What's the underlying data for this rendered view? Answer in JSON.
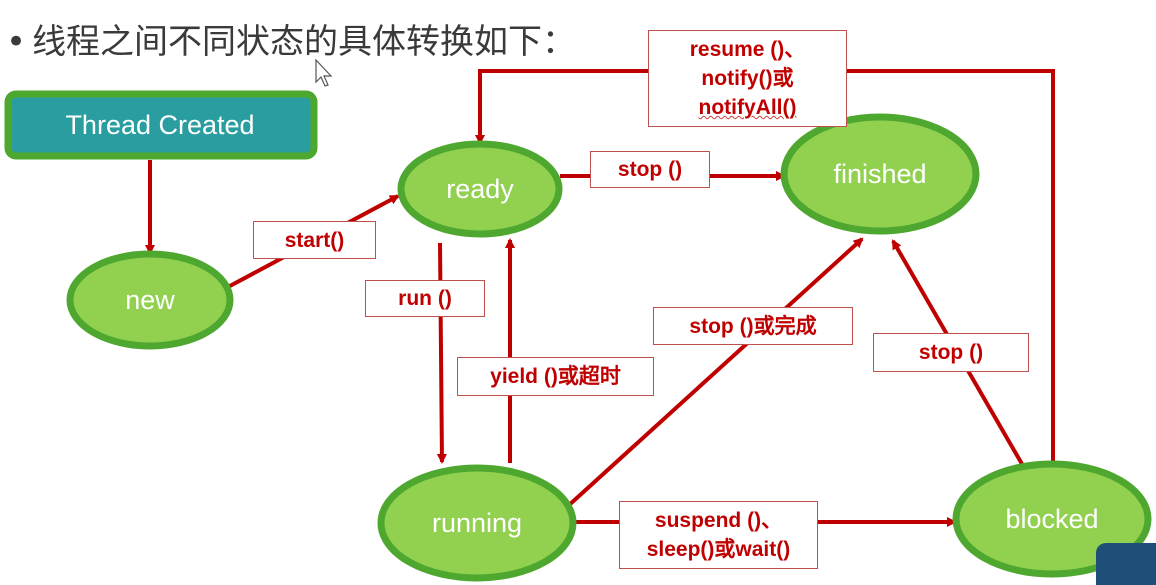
{
  "heading": "线程之间不同状态的具体转换如下：",
  "states": {
    "thread_created": "Thread Created",
    "new": "new",
    "ready": "ready",
    "finished": "finished",
    "running": "running",
    "blocked": "blocked"
  },
  "transitions": {
    "start": "start()",
    "run": "run ()",
    "yield": "yield ()或超时",
    "stop_ready_finished": "stop ()",
    "stop_running_finished": "stop ()或完成",
    "stop_blocked_finished": "stop ()",
    "resume_line1": "resume ()、",
    "resume_line2": "notify()或",
    "resume_line3": "notifyAll()",
    "suspend_line1": "suspend ()、",
    "suspend_line2": "sleep()或wait()"
  },
  "colors": {
    "state_fill": "#92d050",
    "state_border": "#4ea72e",
    "created_fill": "#2a9da0",
    "arrow": "#c00000",
    "label_border": "#c0504d"
  },
  "icons": {
    "cursor": "mouse-pointer-icon"
  }
}
